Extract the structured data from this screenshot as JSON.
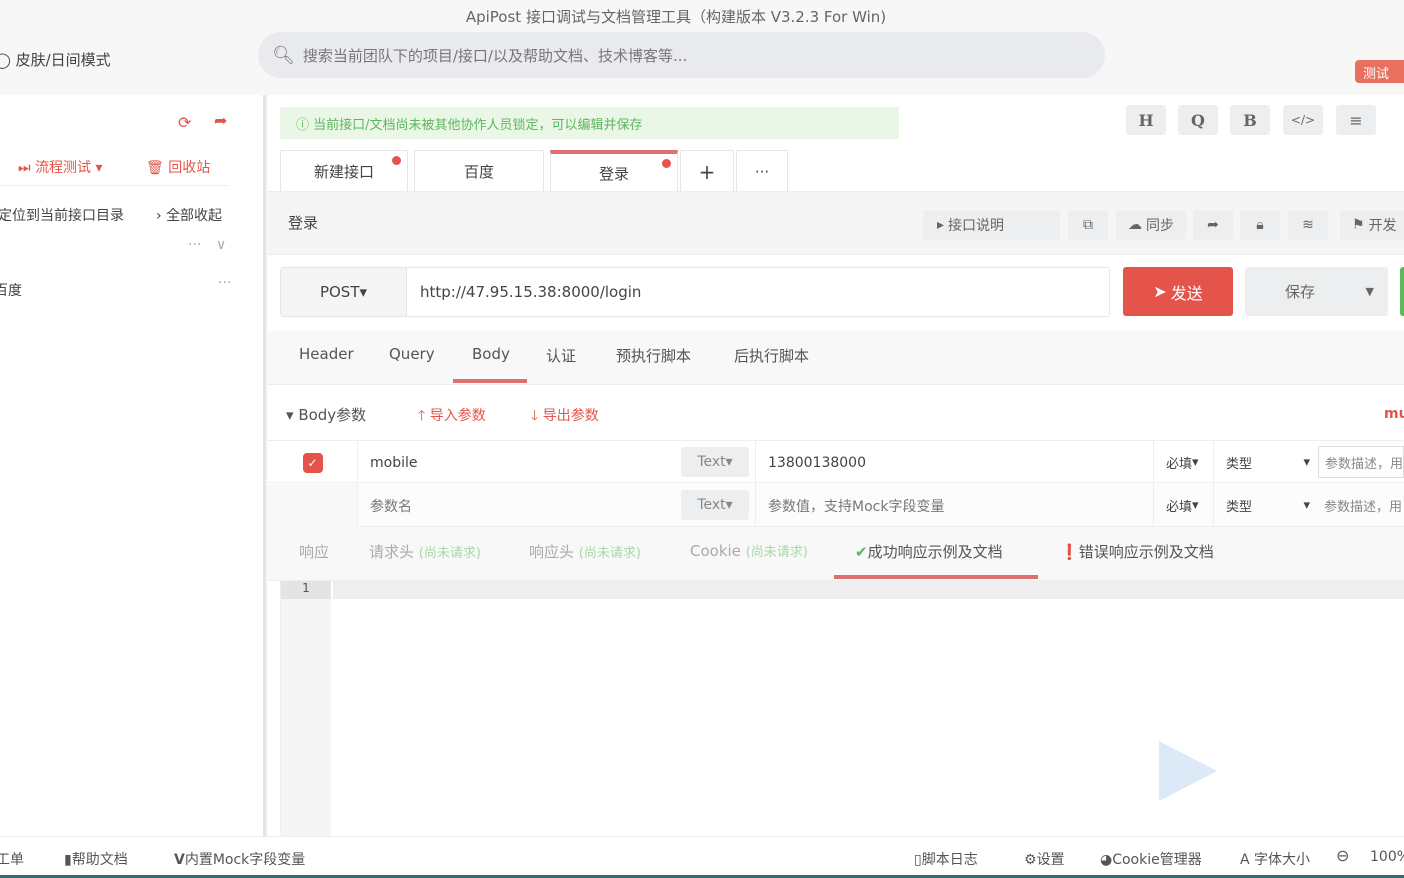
{
  "window": {
    "title": "ApiPost 接口调试与文档管理工具（构建版本 V3.2.3 For Win)"
  },
  "header": {
    "skin": "皮肤/日间模式",
    "search_placeholder": "搜索当前团队下的项目/接口/以及帮助文档、技术博客等...",
    "badge": "测试"
  },
  "sidebar": {
    "flow_test": "流程测试",
    "recycle": "回收站",
    "locate": "定位到当前接口目录",
    "collapse": "全部收起",
    "item": "百度"
  },
  "notice": "当前接口/文档尚未被其他协作人员锁定，可以编辑并保存",
  "toolbar": [
    "H",
    "Q",
    "B",
    "</>",
    "≡"
  ],
  "tabs": [
    {
      "label": "新建接口"
    },
    {
      "label": "百度"
    },
    {
      "label": "登录"
    }
  ],
  "api": {
    "name": "登录",
    "doc": "接口说明",
    "sync": "同步",
    "dev": "开发"
  },
  "request": {
    "method": "POST",
    "url": "http://47.95.15.38:8000/login",
    "send": "发送",
    "save": "保存"
  },
  "req_tabs": [
    "Header",
    "Query",
    "Body",
    "认证",
    "预执行脚本",
    "后执行脚本"
  ],
  "body": {
    "title": "Body参数",
    "import": "导入参数",
    "export": "导出参数",
    "mode": "mu"
  },
  "params": [
    {
      "name": "mobile",
      "type": "Text",
      "value": "13800138000",
      "required": "必填",
      "kind": "类型",
      "desc": "参数描述，用"
    },
    {
      "name": "参数名",
      "type": "Text",
      "value": "参数值，支持Mock字段变量",
      "required": "必填",
      "kind": "类型",
      "desc": "参数描述，用"
    }
  ],
  "resp_tabs": {
    "resp": "响应",
    "req_head": "请求头",
    "resp_head": "响应头",
    "cookie": "Cookie",
    "pending": "(尚未请求)",
    "success": "成功响应示例及文档",
    "error": "错误响应示例及文档"
  },
  "editor": {
    "line": "1"
  },
  "footer": {
    "ticket": "工单",
    "help": "帮助文档",
    "mock": "内置Mock字段变量",
    "log": "脚本日志",
    "settings": "设置",
    "cookie": "Cookie管理器",
    "font": "字体大小",
    "zoom": "100%"
  }
}
